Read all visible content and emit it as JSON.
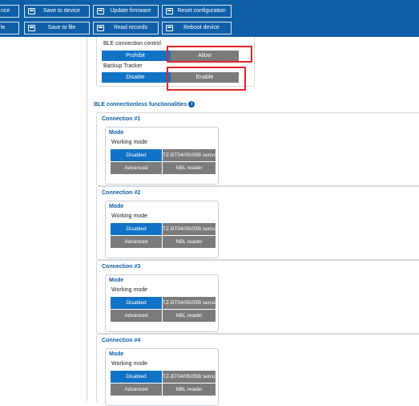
{
  "toolbar": {
    "row1": [
      {
        "label": "nce",
        "icon": "partial-button-icon"
      },
      {
        "label": "Save to device",
        "icon": "save-device-icon"
      },
      {
        "label": "Update firmware",
        "icon": "update-firmware-icon"
      },
      {
        "label": "Reset configuration",
        "icon": "reset-icon"
      }
    ],
    "row2": [
      {
        "label": "le",
        "icon": "partial-button-icon"
      },
      {
        "label": "Save to file",
        "icon": "save-file-icon"
      },
      {
        "label": "Read records",
        "icon": "read-records-icon"
      },
      {
        "label": "Reboot device",
        "icon": "reboot-icon"
      }
    ]
  },
  "ble": {
    "connection_control": {
      "label": "BLE connection control",
      "options": [
        "Prohibit",
        "Allow"
      ],
      "selected": "Allow"
    },
    "backup_tracker": {
      "label": "Backup Tracker",
      "options": [
        "Disable",
        "Enable"
      ],
      "selected": "Enable"
    }
  },
  "connectionless": {
    "title": "BLE connectionless functionalities",
    "connections": [
      {
        "title": "Connection #1",
        "mode_title": "Mode",
        "working_mode_label": "Working mode",
        "options": [
          "Disabled",
          "TZ-BT04/05/05B sensor",
          "Advanced",
          "NBL reader"
        ],
        "selected": "Disabled"
      },
      {
        "title": "Connection #2",
        "mode_title": "Mode",
        "working_mode_label": "Working mode",
        "options": [
          "Disabled",
          "TZ-BT04/05/05B sensor",
          "Advanced",
          "NBL reader"
        ],
        "selected": "Disabled"
      },
      {
        "title": "Connection #3",
        "mode_title": "Mode",
        "working_mode_label": "Working mode",
        "options": [
          "Disabled",
          "TZ-BT04/05/05B sensor",
          "Advanced",
          "NBL reader"
        ],
        "selected": "Disabled"
      },
      {
        "title": "Connection #4",
        "mode_title": "Mode",
        "working_mode_label": "Working mode",
        "options": [
          "Disabled",
          "TZ-BT04/05/05B sensor",
          "Advanced",
          "NBL reader"
        ],
        "selected": "Disabled"
      }
    ]
  },
  "colors": {
    "toolbar_bg": "#0e5fa7",
    "selected": "#1173c6",
    "unselected": "#7b7b7b",
    "highlight": "#e0252a"
  }
}
